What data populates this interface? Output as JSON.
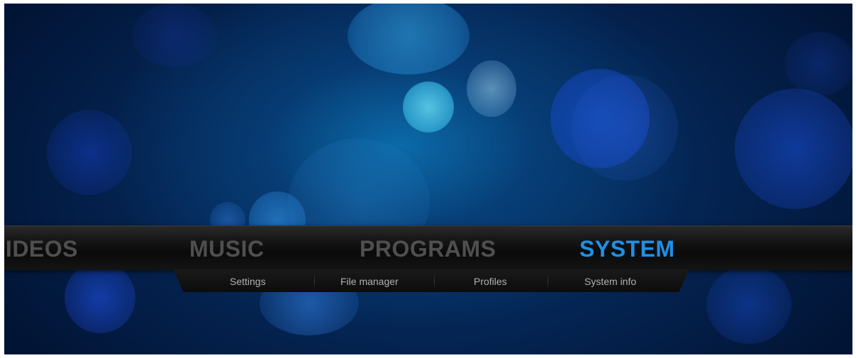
{
  "home_menu": {
    "items": [
      {
        "label": "VIDEOS",
        "state": "partially-offscreen"
      },
      {
        "label": "MUSIC",
        "state": "inactive"
      },
      {
        "label": "PROGRAMS",
        "state": "inactive"
      },
      {
        "label": "SYSTEM",
        "state": "selected"
      }
    ]
  },
  "submenu": {
    "items": [
      {
        "label": "Settings"
      },
      {
        "label": "File manager"
      },
      {
        "label": "Profiles"
      },
      {
        "label": "System info"
      }
    ]
  },
  "colors": {
    "selected": "#1e90e8",
    "inactive": "#4f4f4f",
    "submenu_text": "#b0b0b0",
    "background": "#06396f"
  }
}
